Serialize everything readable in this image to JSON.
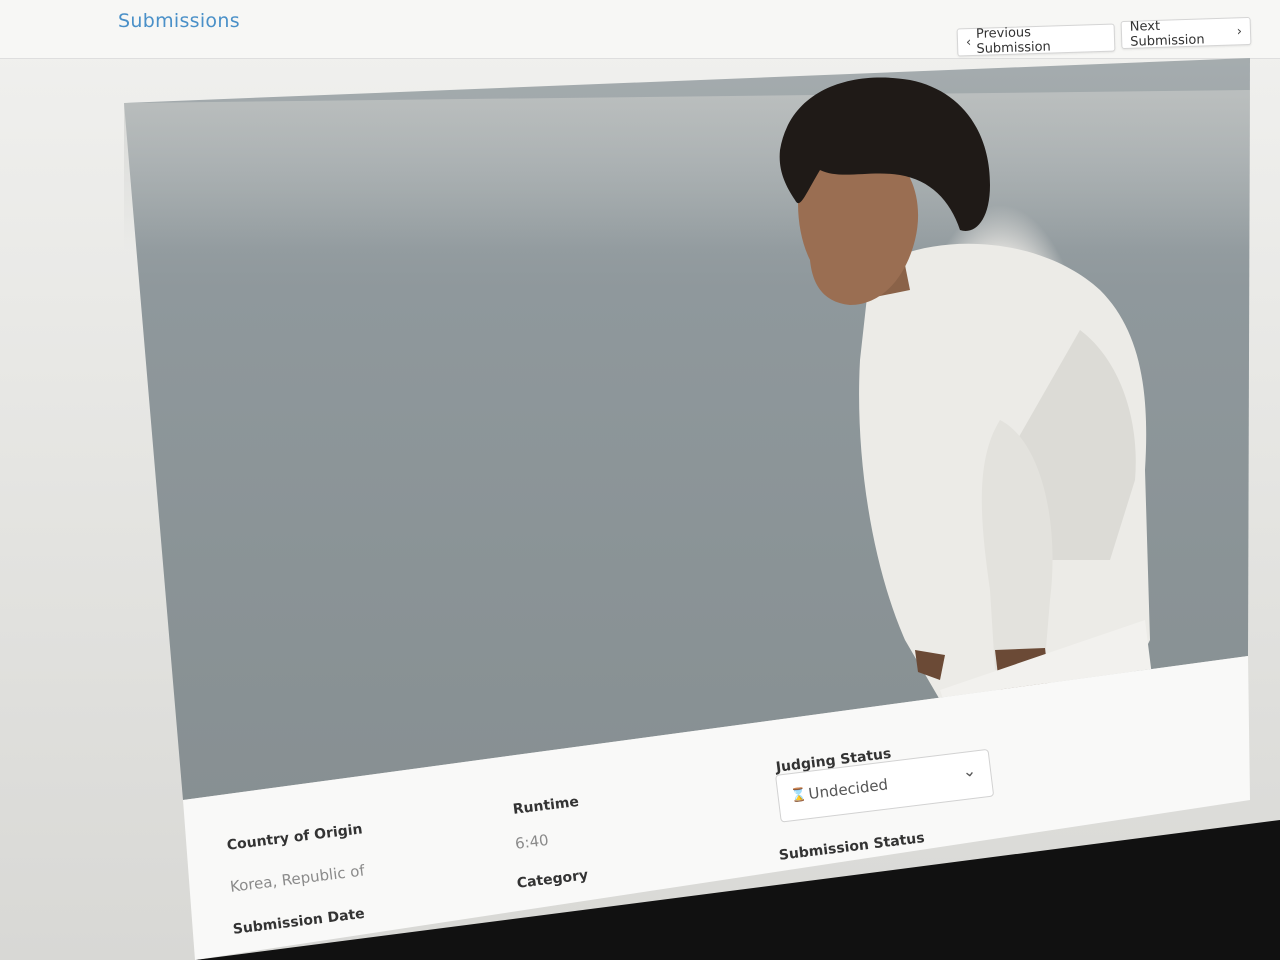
{
  "header": {
    "title": "Submissions",
    "prev_label": "Previous Submission",
    "next_label": "Next Submission"
  },
  "video": {
    "thumbnail": "person-in-white-sweatshirt-by-sea"
  },
  "details": {
    "country_label": "Country of Origin",
    "country_value": "Korea, Republic of",
    "submission_date_label": "Submission Date",
    "runtime_label": "Runtime",
    "runtime_value": "6:40",
    "category_label": "Category",
    "judging_status_label": "Judging Status",
    "judging_status_value": "Undecided",
    "submission_status_label": "Submission Status"
  },
  "icons": {
    "prev": "chevron-left-icon",
    "next": "chevron-right-icon",
    "status": "hourglass-icon",
    "dropdown": "chevron-down-icon"
  },
  "colors": {
    "title": "#4a90c8"
  }
}
